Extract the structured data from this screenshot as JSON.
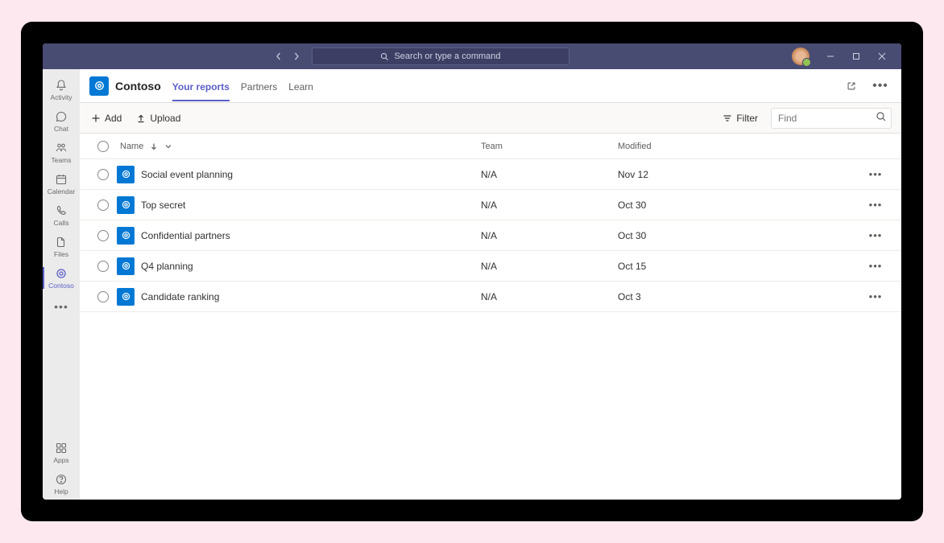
{
  "search": {
    "placeholder": "Search or type a command"
  },
  "rail": {
    "items": [
      {
        "label": "Activity",
        "icon": "bell"
      },
      {
        "label": "Chat",
        "icon": "chat"
      },
      {
        "label": "Teams",
        "icon": "teams"
      },
      {
        "label": "Calendar",
        "icon": "calendar"
      },
      {
        "label": "Calls",
        "icon": "calls"
      },
      {
        "label": "Files",
        "icon": "files"
      },
      {
        "label": "Contoso",
        "icon": "contoso",
        "active": true
      }
    ],
    "bottom": [
      {
        "label": "Apps",
        "icon": "apps"
      },
      {
        "label": "Help",
        "icon": "help"
      }
    ]
  },
  "header": {
    "app_name": "Contoso",
    "tabs": [
      {
        "label": "Your reports",
        "active": true
      },
      {
        "label": "Partners"
      },
      {
        "label": "Learn"
      }
    ]
  },
  "toolbar": {
    "add_label": "Add",
    "upload_label": "Upload",
    "filter_label": "Filter",
    "find_placeholder": "Find"
  },
  "table": {
    "columns": {
      "name": "Name",
      "team": "Team",
      "modified": "Modified"
    },
    "rows": [
      {
        "name": "Social event planning",
        "team": "N/A",
        "modified": "Nov 12"
      },
      {
        "name": "Top secret",
        "team": "N/A",
        "modified": "Oct 30"
      },
      {
        "name": "Confidential partners",
        "team": "N/A",
        "modified": "Oct 30"
      },
      {
        "name": "Q4 planning",
        "team": "N/A",
        "modified": "Oct 15"
      },
      {
        "name": "Candidate ranking",
        "team": "N/A",
        "modified": "Oct 3"
      }
    ]
  }
}
